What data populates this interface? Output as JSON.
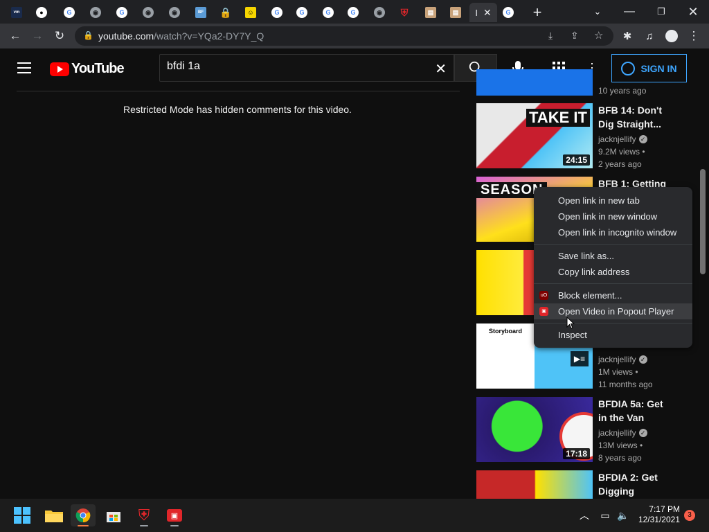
{
  "browser": {
    "active_tab_label": "I",
    "url_host": "youtube.com",
    "url_path": "/watch?v=YQa2-DY7Y_Q"
  },
  "youtube": {
    "logo_text": "YouTube",
    "search_value": "bfdi 1a",
    "sign_in": "SIGN IN",
    "restricted_message": "Restricted Mode has hidden comments for this video."
  },
  "sidebar": {
    "videos": [
      {
        "title": "",
        "channel": "",
        "meta2": "10 years ago"
      },
      {
        "title": "BFB 14: Don't Dig Straight...",
        "channel": "jacknjellify",
        "views": "9.2M views •",
        "age": "2 years ago",
        "duration": "24:15",
        "thumb_text": "TAKE IT"
      },
      {
        "title": "BFB 1: Getting",
        "thumb_text": "SEASON"
      },
      {
        "title": ""
      },
      {
        "title": "",
        "channel": "jacknjellify",
        "views": "1M views •",
        "age": "11 months ago",
        "thumb_text": "Storyboard"
      },
      {
        "title": "BFDIA 5a: Get in the Van",
        "channel": "jacknjellify",
        "views": "13M views •",
        "age": "8 years ago",
        "duration": "17:18"
      },
      {
        "title": "BFDIA 2: Get Digging"
      }
    ]
  },
  "context_menu": {
    "items": [
      "Open link in new tab",
      "Open link in new window",
      "Open link in incognito window",
      "Save link as...",
      "Copy link address",
      "Block element...",
      "Open Video in Popout Player",
      "Inspect"
    ]
  },
  "taskbar": {
    "time": "7:17 PM",
    "date": "12/31/2021",
    "notifications": "3"
  },
  "colors": {
    "youtube_red": "#ff0000",
    "signin_blue": "#3ea6ff",
    "chrome_dark": "#202124"
  }
}
